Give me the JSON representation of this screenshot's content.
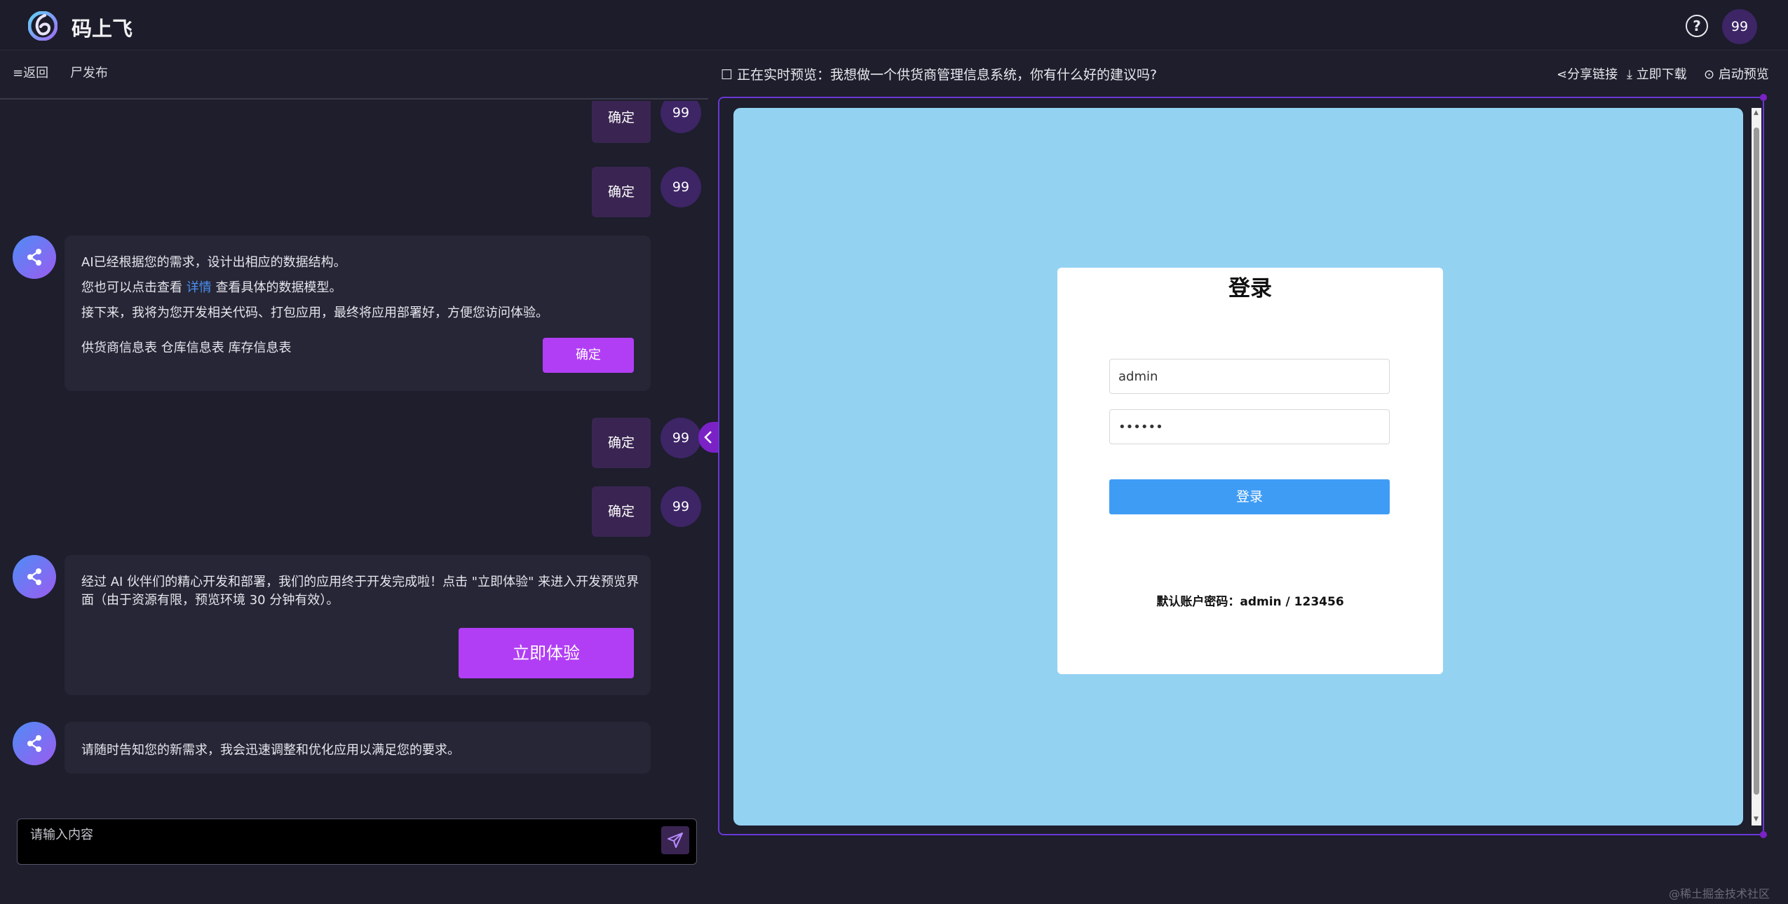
{
  "app": {
    "brand": "码上飞",
    "user_avatar": "99"
  },
  "left_toolbar": {
    "back_label": "≡返回",
    "publish_label": "尸发布"
  },
  "chat": {
    "confirm_label": "确定",
    "user_avatar": "99",
    "msg1": {
      "line1": "AI已经根据您的需求，设计出相应的数据结构。",
      "line2_prefix": "您也可以点击查看 ",
      "line2_link": "详情",
      "line2_suffix": " 查看具体的数据模型。",
      "line3": "接下来，我将为您开发相关代码、打包应用，最终将应用部署好，方便您访问体验。",
      "tables": "供货商信息表 仓库信息表 库存信息表",
      "confirm_button": "确定"
    },
    "msg2": {
      "line1": "经过 AI 伙伴们的精心开发和部署，我们的应用终于开发完成啦！点击 \"立即体验\" 来进入开发预览界",
      "line2": "面（由于资源有限，预览环境 30 分钟有效）。",
      "try_button": "立即体验"
    },
    "msg3": {
      "line1": "请随时告知您的新需求，我会迅速调整和优化应用以满足您的要求。"
    },
    "input_placeholder": "请输入内容"
  },
  "preview": {
    "title": "正在实时预览：我想做一个供货商管理信息系统，你有什么好的建议吗?",
    "share_label": "分享链接",
    "download_label": "立即下载",
    "launch_label": "启动预览"
  },
  "login": {
    "title": "登录",
    "username_value": "admin",
    "password_value": "••••••",
    "button_label": "登录",
    "hint": "默认账户密码：admin / 123456"
  },
  "watermark": "@稀土掘金技术社区"
}
